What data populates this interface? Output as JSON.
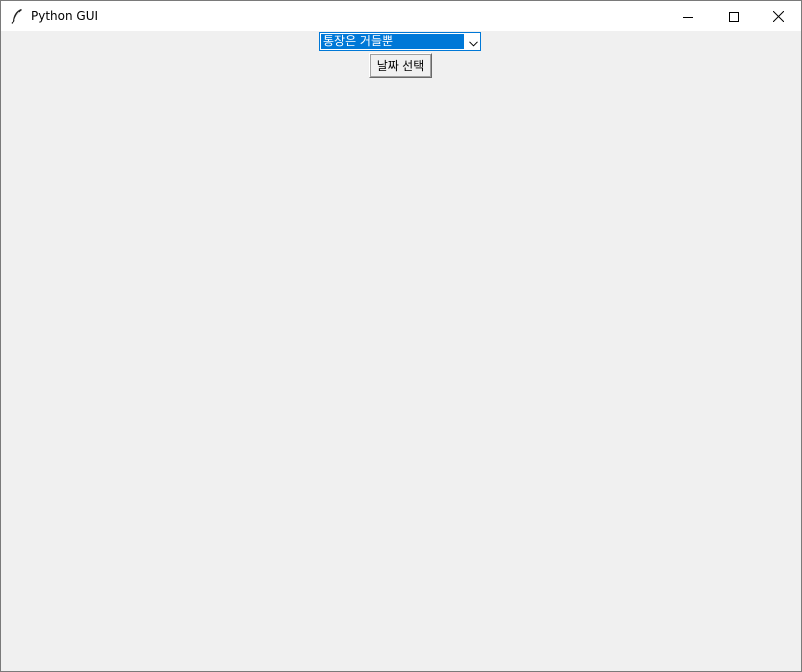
{
  "window": {
    "title": "Python GUI",
    "app_icon": "feather-icon",
    "controls": {
      "minimize_icon": "minimize-icon",
      "maximize_icon": "maximize-icon",
      "close_icon": "close-icon"
    }
  },
  "form": {
    "combobox": {
      "selected_value": "통장은 거들뿐",
      "dropdown_icon": "chevron-down-icon"
    },
    "date_button": {
      "label": "날짜 선택"
    }
  },
  "colors": {
    "selection_blue": "#0078d7",
    "background": "#f0f0f0",
    "titlebar": "#ffffff"
  }
}
